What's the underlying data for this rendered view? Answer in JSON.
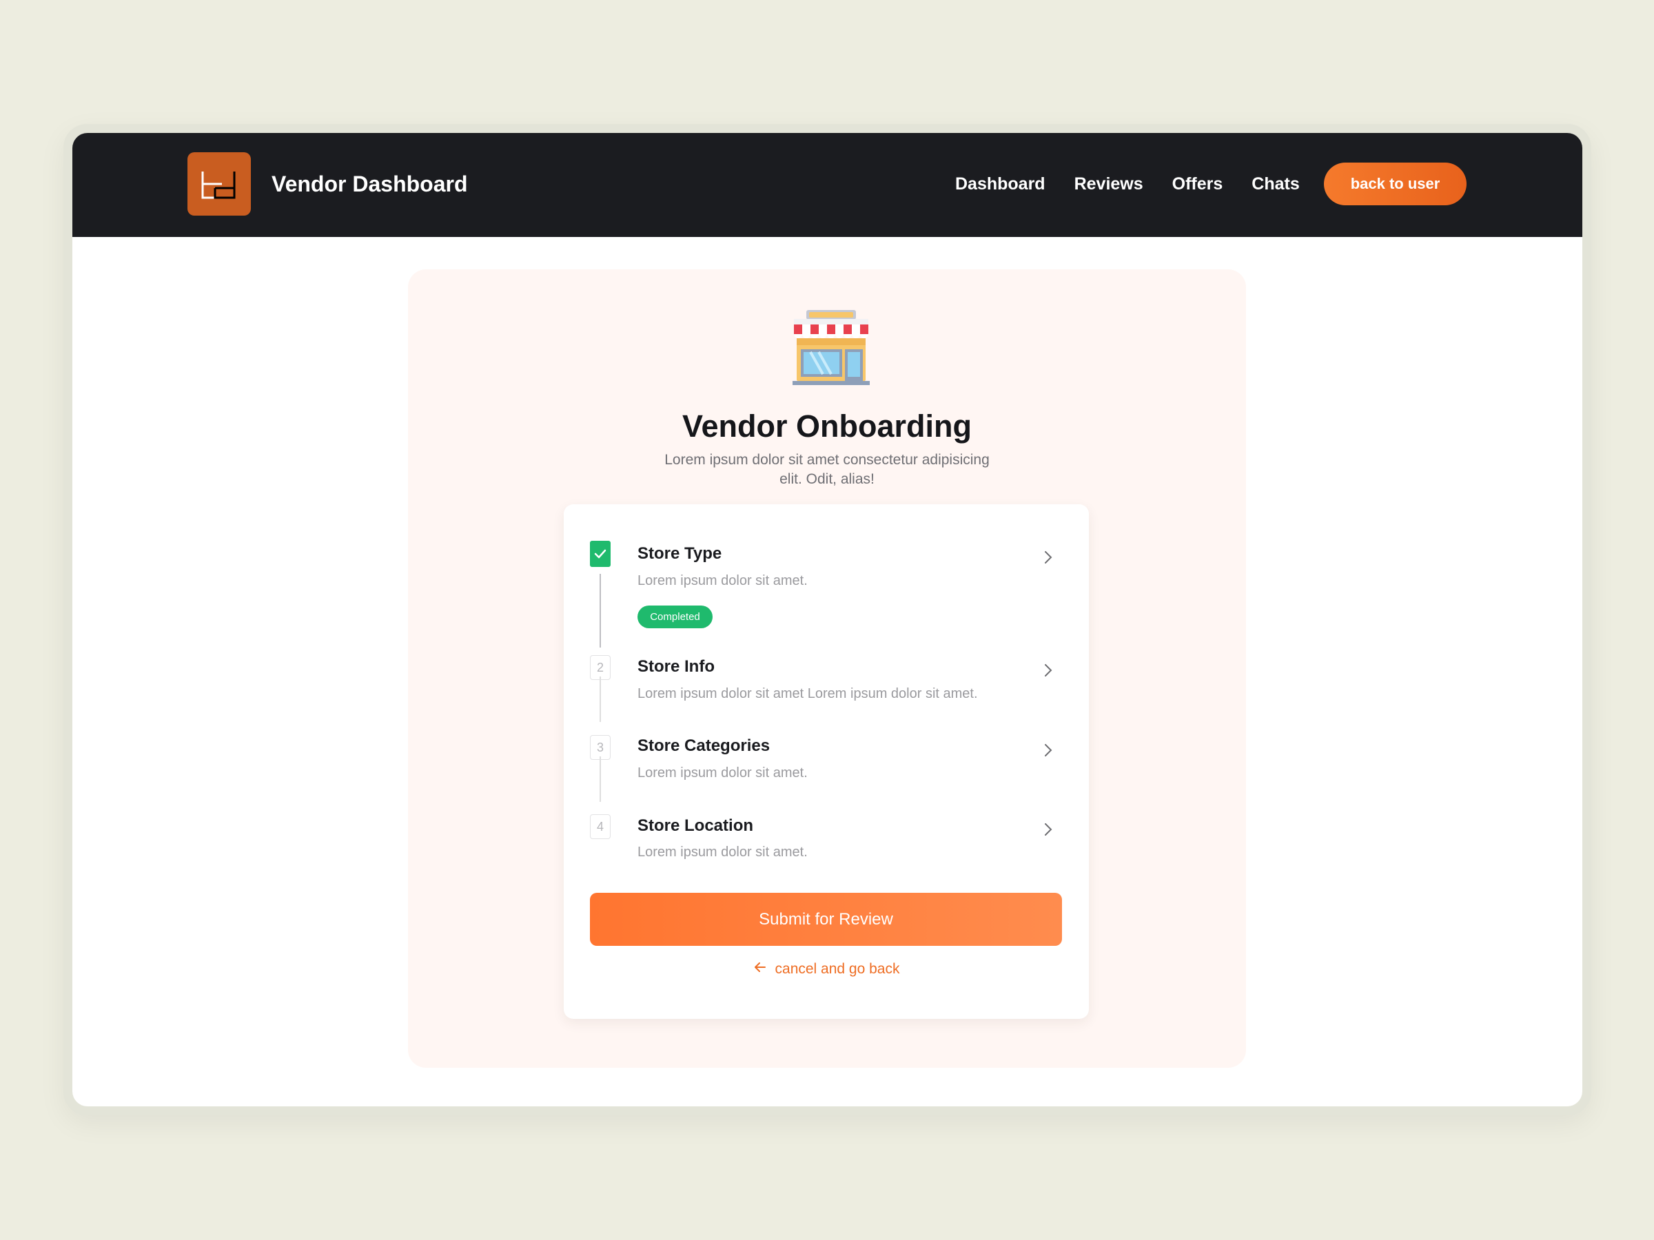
{
  "navbar": {
    "brand": "Vendor Dashboard",
    "logo_icon": "bd-monogram-logo",
    "links": [
      "Dashboard",
      "Reviews",
      "Offers",
      "Chats"
    ],
    "back_button": "back to user"
  },
  "onboarding": {
    "icon": "storefront-icon",
    "title": "Vendor Onboarding",
    "subtitle": "Lorem ipsum dolor sit amet consectetur adipisicing elit. Odit, alias!",
    "steps": [
      {
        "number": "",
        "title": "Store Type",
        "description": "Lorem ipsum dolor sit amet.",
        "status": "Completed"
      },
      {
        "number": "2",
        "title": "Store Info",
        "description": "Lorem ipsum dolor sit amet Lorem ipsum dolor sit amet."
      },
      {
        "number": "3",
        "title": "Store Categories",
        "description": "Lorem ipsum dolor sit amet."
      },
      {
        "number": "4",
        "title": "Store Location",
        "description": "Lorem ipsum dolor sit amet."
      }
    ],
    "submit_label": "Submit for Review",
    "cancel_label": "cancel and go back"
  },
  "colors": {
    "accent": "#ff7530",
    "success": "#1fba6d",
    "navbar": "#1b1c20",
    "page_background": "#edede0"
  }
}
